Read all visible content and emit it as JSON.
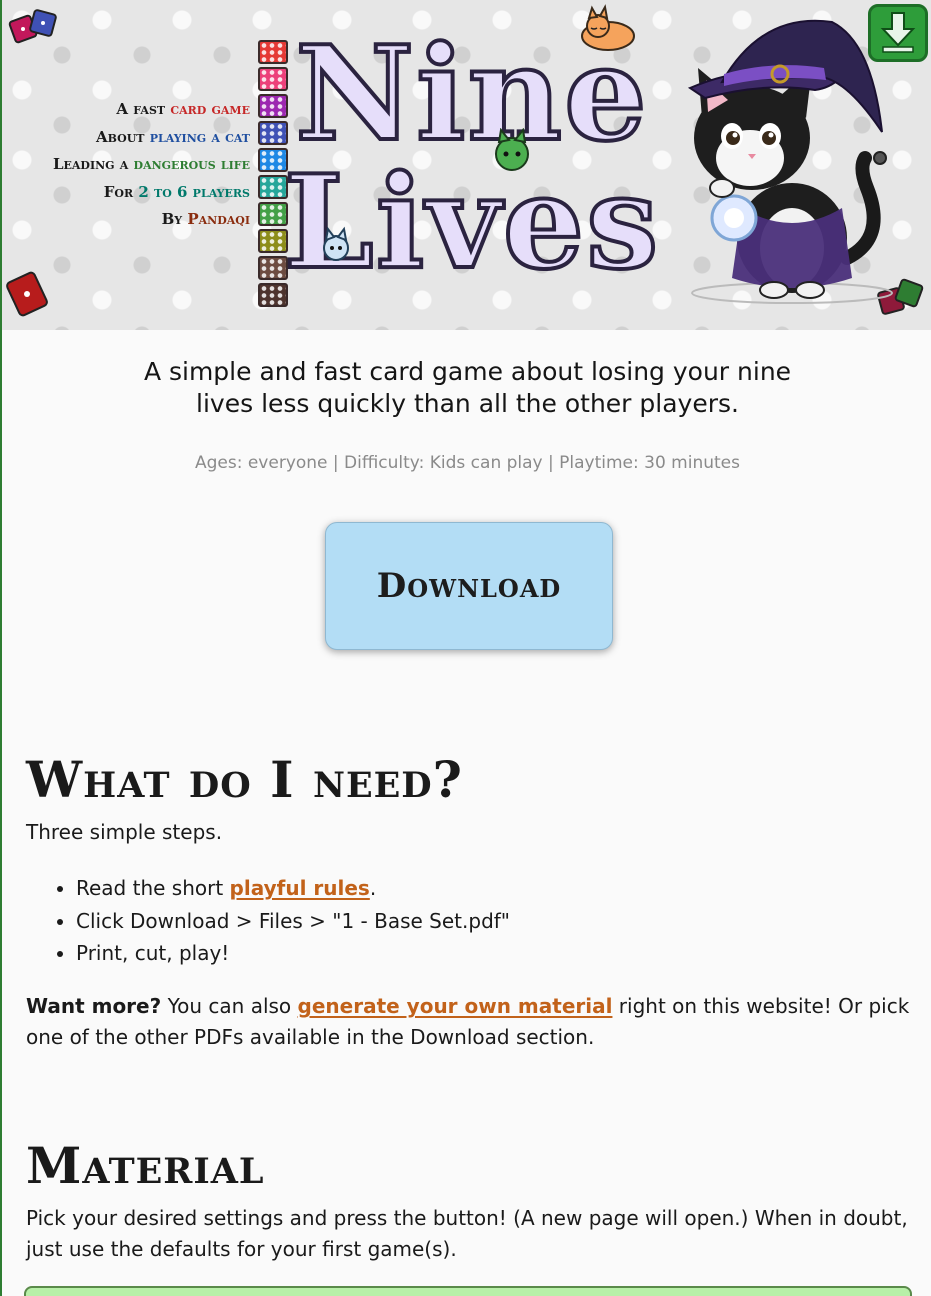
{
  "header": {
    "tagline": [
      {
        "pre": "A fast ",
        "highlight": "card game",
        "color": "#c62828"
      },
      {
        "pre": "About ",
        "highlight": "playing a cat",
        "color": "#1f4fa0"
      },
      {
        "pre": "Leading a ",
        "highlight": "dangerous life",
        "color": "#2e7d32"
      },
      {
        "pre": "For ",
        "highlight": "2 to 6 players",
        "color": "#00796b"
      },
      {
        "pre": "By ",
        "highlight": "Pandaqi",
        "color": "#8a2c0e"
      }
    ],
    "title_line1": "Nine",
    "title_line2": "Lives",
    "dice_colors": [
      "#e53935",
      "#ec407a",
      "#9c27b0",
      "#3f51b5",
      "#1e88e5",
      "#26a69a",
      "#43a047",
      "#8d8d1a",
      "#6d4c41",
      "#4e342e"
    ]
  },
  "intro": {
    "line1": "A simple and fast card game about losing your nine",
    "line2": "lives less quickly than all the other players.",
    "meta": "Ages: everyone | Difficulty: Kids can play | Playtime: 30 minutes"
  },
  "download_button": "Download",
  "section_need": {
    "heading": "What do I need?",
    "intro": "Three simple steps.",
    "step1_pre": "Read the short ",
    "step1_link": "playful rules",
    "step1_post": ".",
    "step2": "Click Download > Files > \"1 - Base Set.pdf\"",
    "step3": "Print, cut, play!",
    "more_bold": "Want more?",
    "more_pre": " You can also ",
    "more_link": "generate your own material",
    "more_post": " right on this website! Or pick one of the other PDFs available in the Download section."
  },
  "section_material": {
    "heading": "Material",
    "text": "Pick your desired settings and press the button! (A new page will open.) When in doubt, just use the defaults for your first game(s)."
  },
  "colors": {
    "accent_link": "#c2621a",
    "download_bg": "#b3ddf5",
    "settings_bg": "#b8f0a8"
  }
}
